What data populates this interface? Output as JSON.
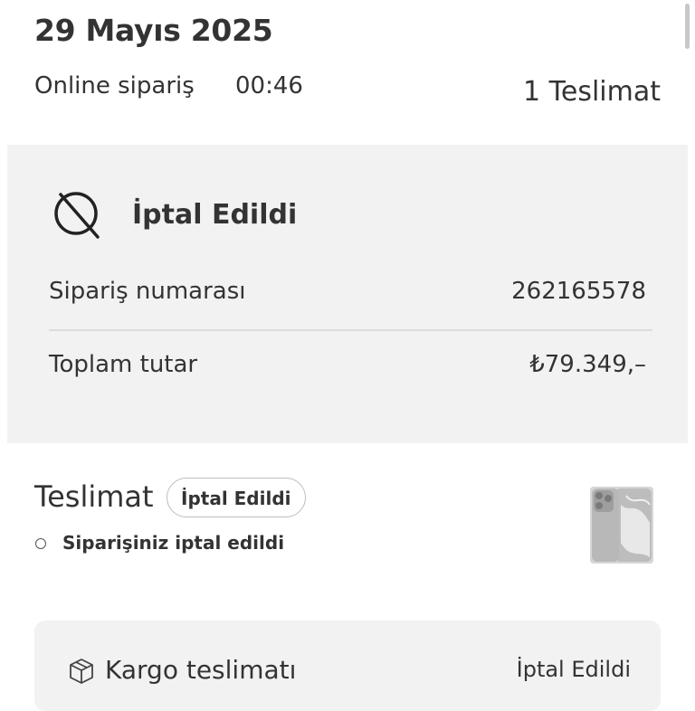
{
  "header": {
    "date": "29 Mayıs 2025",
    "order_type": "Online sipariş",
    "order_time": "00:46",
    "delivery_count": "1 Teslimat"
  },
  "status_card": {
    "icon": "cancelled-icon",
    "title": "İptal Edildi",
    "order_number_label": "Sipariş numarası",
    "order_number_value": "262165578",
    "total_label": "Toplam tutar",
    "total_value": "₺79.349,–"
  },
  "delivery": {
    "title": "Teslimat",
    "badge": "İptal Edildi",
    "status_text": "Siparişiniz iptal edildi",
    "product_image": "phone-product-image"
  },
  "cargo": {
    "icon": "box-icon",
    "label": "Kargo teslimatı",
    "status": "İptal Edildi"
  },
  "colors": {
    "text": "#333333",
    "card_background": "#f2f2f2",
    "divider": "#dcdcdc",
    "badge_border": "#bdbdbd"
  }
}
